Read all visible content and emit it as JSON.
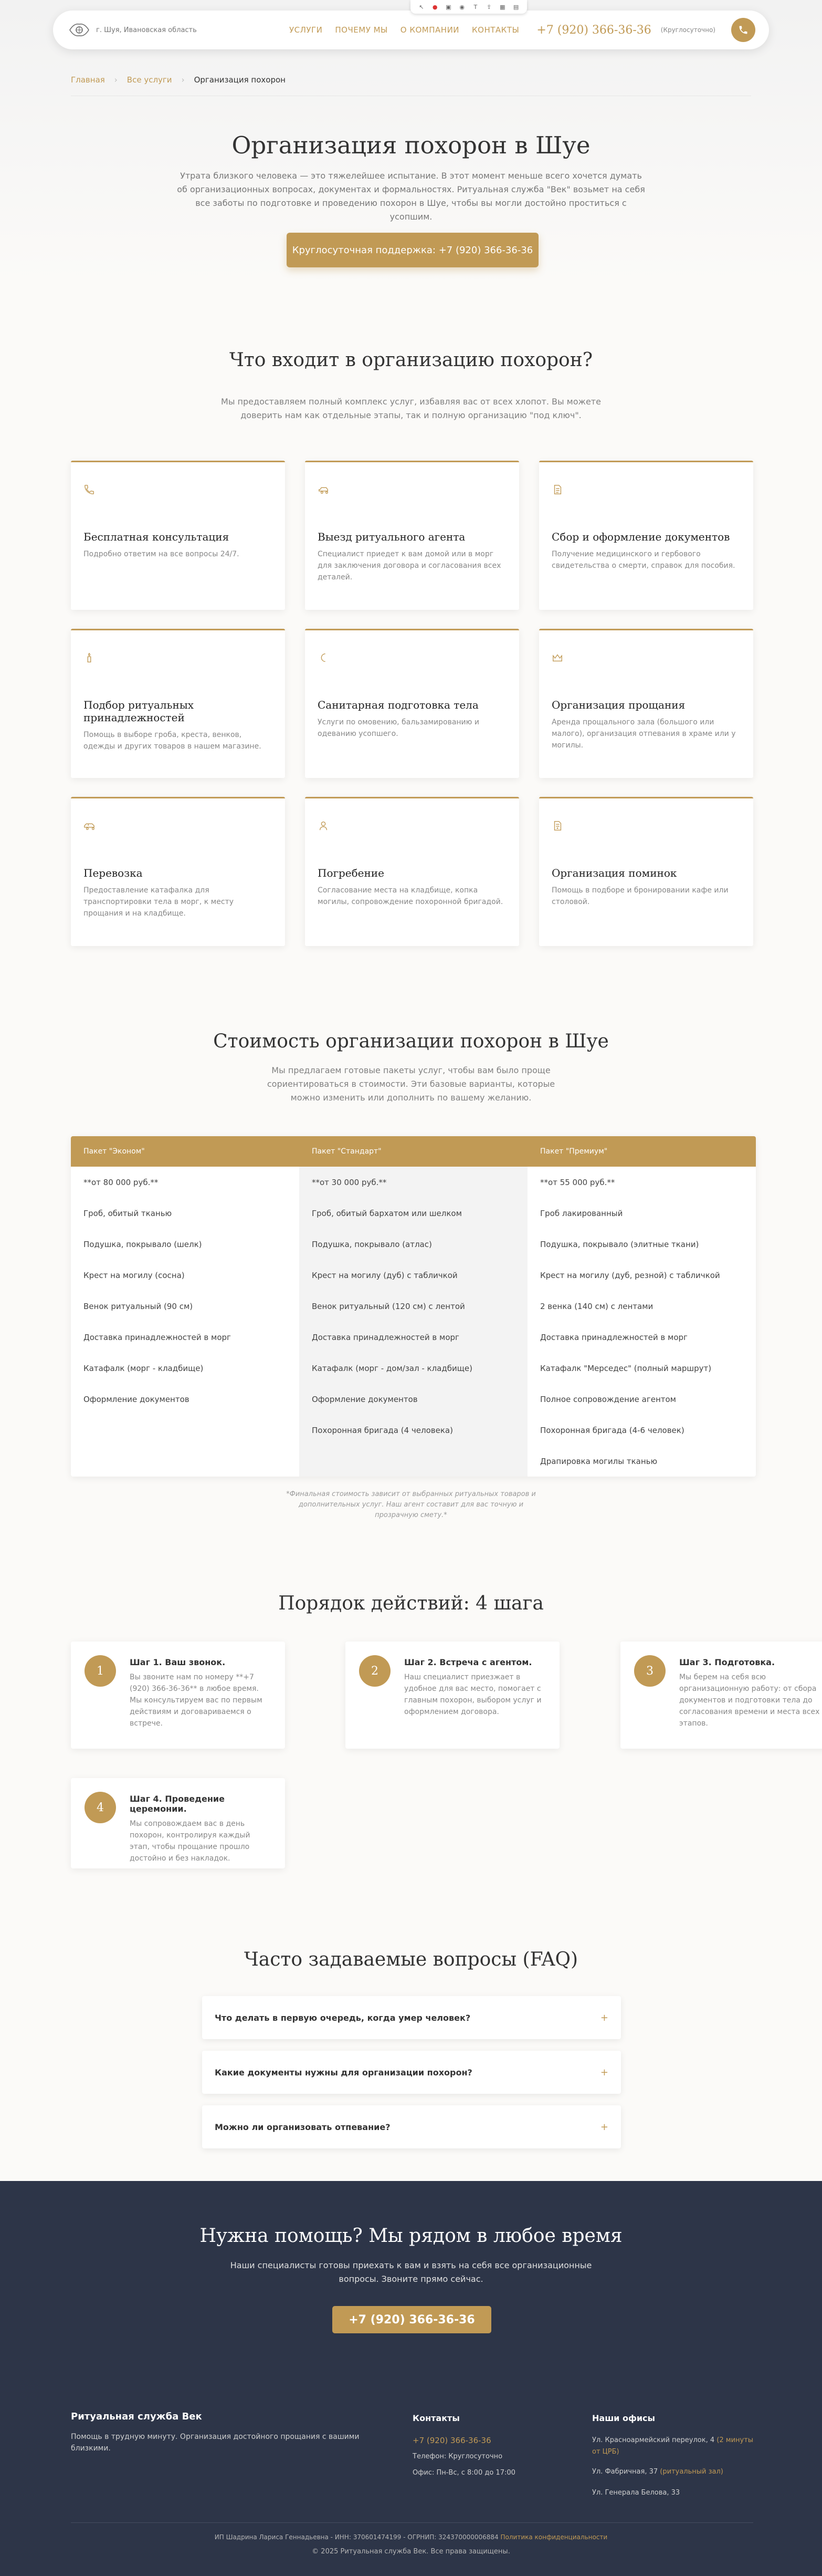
{
  "header": {
    "city": "г. Шуя, Ивановская область",
    "nav": [
      "УСЛУГИ",
      "ПОЧЕМУ МЫ",
      "О КОМПАНИИ",
      "КОНТАКТЫ"
    ],
    "phone": "+7 (920) 366-36-36",
    "hours": "(Круглосуточно)"
  },
  "breadcrumbs": {
    "home": "Главная",
    "services": "Все услуги",
    "current": "Организация похорон"
  },
  "hero": {
    "title": "Организация похорон в Шуе",
    "text": "Утрата близкого человека — это тяжелейшее испытание. В этот момент меньше всего хочется думать об организационных вопросах, документах и формальностях. Ритуальная служба \"Век\" возьмет на себя все заботы по подготовке и проведению похорон в Шуе, чтобы вы могли достойно проститься с усопшим.",
    "button": "Круглосуточная поддержка: +7 (920) 366-36-36"
  },
  "services": {
    "title": "Что входит в организацию похорон?",
    "subtitle": "Мы предоставляем полный комплекс услуг, избавляя вас от всех хлопот. Вы можете доверить нам как отдельные этапы, так и полную организацию \"под ключ\".",
    "items": [
      {
        "icon": "phone-icon",
        "title": "Бесплатная консультация",
        "desc": "Подробно ответим на все вопросы 24/7."
      },
      {
        "icon": "car-icon",
        "title": "Выезд ритуального агента",
        "desc": "Специалист приедет к вам домой или в морг для заключения договора и согласования всех деталей."
      },
      {
        "icon": "document-icon",
        "title": "Сбор и оформление документов",
        "desc": "Получение медицинского и гербового свидетельства о смерти, справок для пособия."
      },
      {
        "icon": "candle-icon",
        "title": "Подбор ритуальных принадлежностей",
        "desc": "Помощь в выборе гроба, креста, венков, одежды и других товаров в нашем магазине."
      },
      {
        "icon": "moon-icon",
        "title": "Санитарная подготовка тела",
        "desc": "Услуги по омовению, бальзамированию и одеванию усопшего."
      },
      {
        "icon": "crown-icon",
        "title": "Организация прощания",
        "desc": "Аренда прощального зала (большого или малого), организация отпевания в храме или у могилы."
      },
      {
        "icon": "hearse-icon",
        "title": "Перевозка",
        "desc": "Предоставление катафалка для транспортировки тела в морг, к месту прощания и на кладбище."
      },
      {
        "icon": "person-icon",
        "title": "Погребение",
        "desc": "Согласование места на кладбище, копка могилы, сопровождение похоронной бригадой."
      },
      {
        "icon": "memo-icon",
        "title": "Организация поминок",
        "desc": "Помощь в подборе и бронировании кафе или столовой."
      }
    ]
  },
  "pricing": {
    "title": "Стоимость организации похорон в Шуе",
    "subtitle": "Мы предлагаем готовые пакеты услуг, чтобы вам было проще сориентироваться в стоимости. Эти базовые варианты, которые можно изменить или дополнить по вашему желанию.",
    "packages": [
      {
        "name": "Пакет \"Эконом\"",
        "items": [
          "**от 80 000 руб.**",
          "Гроб, обитый тканью",
          "Подушка, покрывало (шелк)",
          "Крест на могилу (сосна)",
          "Венок ритуальный (90 см)",
          "Доставка принадлежностей в морг",
          "Катафалк (морг - кладбище)",
          "Оформление документов"
        ]
      },
      {
        "name": "Пакет \"Стандарт\"",
        "items": [
          "**от 30 000 руб.**",
          "Гроб, обитый бархатом или шелком",
          "Подушка, покрывало (атлас)",
          "Крест на могилу (дуб) с табличкой",
          "Венок ритуальный (120 см) с лентой",
          "Доставка принадлежностей в морг",
          "Катафалк (морг - дом/зал - кладбище)",
          "Оформление документов",
          "Похоронная бригада (4 человека)"
        ]
      },
      {
        "name": "Пакет \"Премиум\"",
        "items": [
          "**от 55 000 руб.**",
          "Гроб лакированный",
          "Подушка, покрывало (элитные ткани)",
          "Крест на могилу (дуб, резной) с табличкой",
          "2 венка (140 см) с лентами",
          "Доставка принадлежностей в морг",
          "Катафалк \"Мерседес\" (полный маршрут)",
          "Полное сопровождение агентом",
          "Похоронная бригада (4-6 человек)",
          "Драпировка могилы тканью"
        ]
      }
    ],
    "note": "*Финальная стоимость зависит от выбранных ритуальных товаров и дополнительных услуг. Наш агент составит для вас точную и прозрачную смету.*"
  },
  "steps": {
    "title": "Порядок действий: 4 шага",
    "items": [
      {
        "num": "1",
        "title": "Шаг 1. Ваш звонок.",
        "desc": "Вы звоните нам по номеру **+7 (920) 366-36-36** в любое время. Мы консультируем вас по первым действиям и договариваемся о встрече."
      },
      {
        "num": "2",
        "title": "Шаг 2. Встреча с агентом.",
        "desc": "Наш специалист приезжает в удобное для вас место, помогает с главным похорон, выбором услуг и оформлением договора."
      },
      {
        "num": "3",
        "title": "Шаг 3. Подготовка.",
        "desc": "Мы берем на себя всю организационную работу: от сбора документов и подготовки тела до согласования времени и места всех этапов."
      },
      {
        "num": "4",
        "title": "Шаг 4. Проведение церемонии.",
        "desc": "Мы сопровождаем вас в день похорон, контролируя каждый этап, чтобы прощание прошло достойно и без накладок."
      }
    ]
  },
  "faq": {
    "title": "Часто задаваемые вопросы (FAQ)",
    "items": [
      "Что делать в первую очередь, когда умер человек?",
      "Какие документы нужны для организации похорон?",
      "Можно ли организовать отпевание?"
    ]
  },
  "cta": {
    "title": "Нужна помощь? Мы рядом в любое время",
    "text": "Наши специалисты готовы приехать к вам и взять на себя все организационные вопросы. Звоните прямо сейчас.",
    "button": "+7 (920) 366-36-36"
  },
  "footer": {
    "brand": "Ритуальная служба Век",
    "brand_text": "Помощь в трудную минуту. Организация достойного прощания с вашими близкими.",
    "contacts_title": "Контакты",
    "contacts_phone": "+7 (920) 366-36-36",
    "contacts_phone_label": "Телефон: Круглосуточно",
    "contacts_hours": "Офис: Пн-Вс, с 8:00 до 17:00",
    "offices_title": "Наши офисы",
    "offices": [
      {
        "addr": "Ул. Красноармейский переулок, 4",
        "extra": "(2 минуты от ЦРБ)"
      },
      {
        "addr": "Ул. Фабричная, 37",
        "extra": "(ритуальный зал)"
      },
      {
        "addr": "Ул. Генерала Белова, 33",
        "extra": ""
      }
    ],
    "legal": "ИП Шадрина Лариса Геннадьевна - ИНН: 370601474199 - ОГРНИП: 324370000006884",
    "privacy": "Политика конфиденциальности",
    "copyright": "© 2025 Ритуальная служба Век. Все права защищены."
  },
  "colors": {
    "accent": "#c19a55",
    "dark": "#2d3548"
  }
}
